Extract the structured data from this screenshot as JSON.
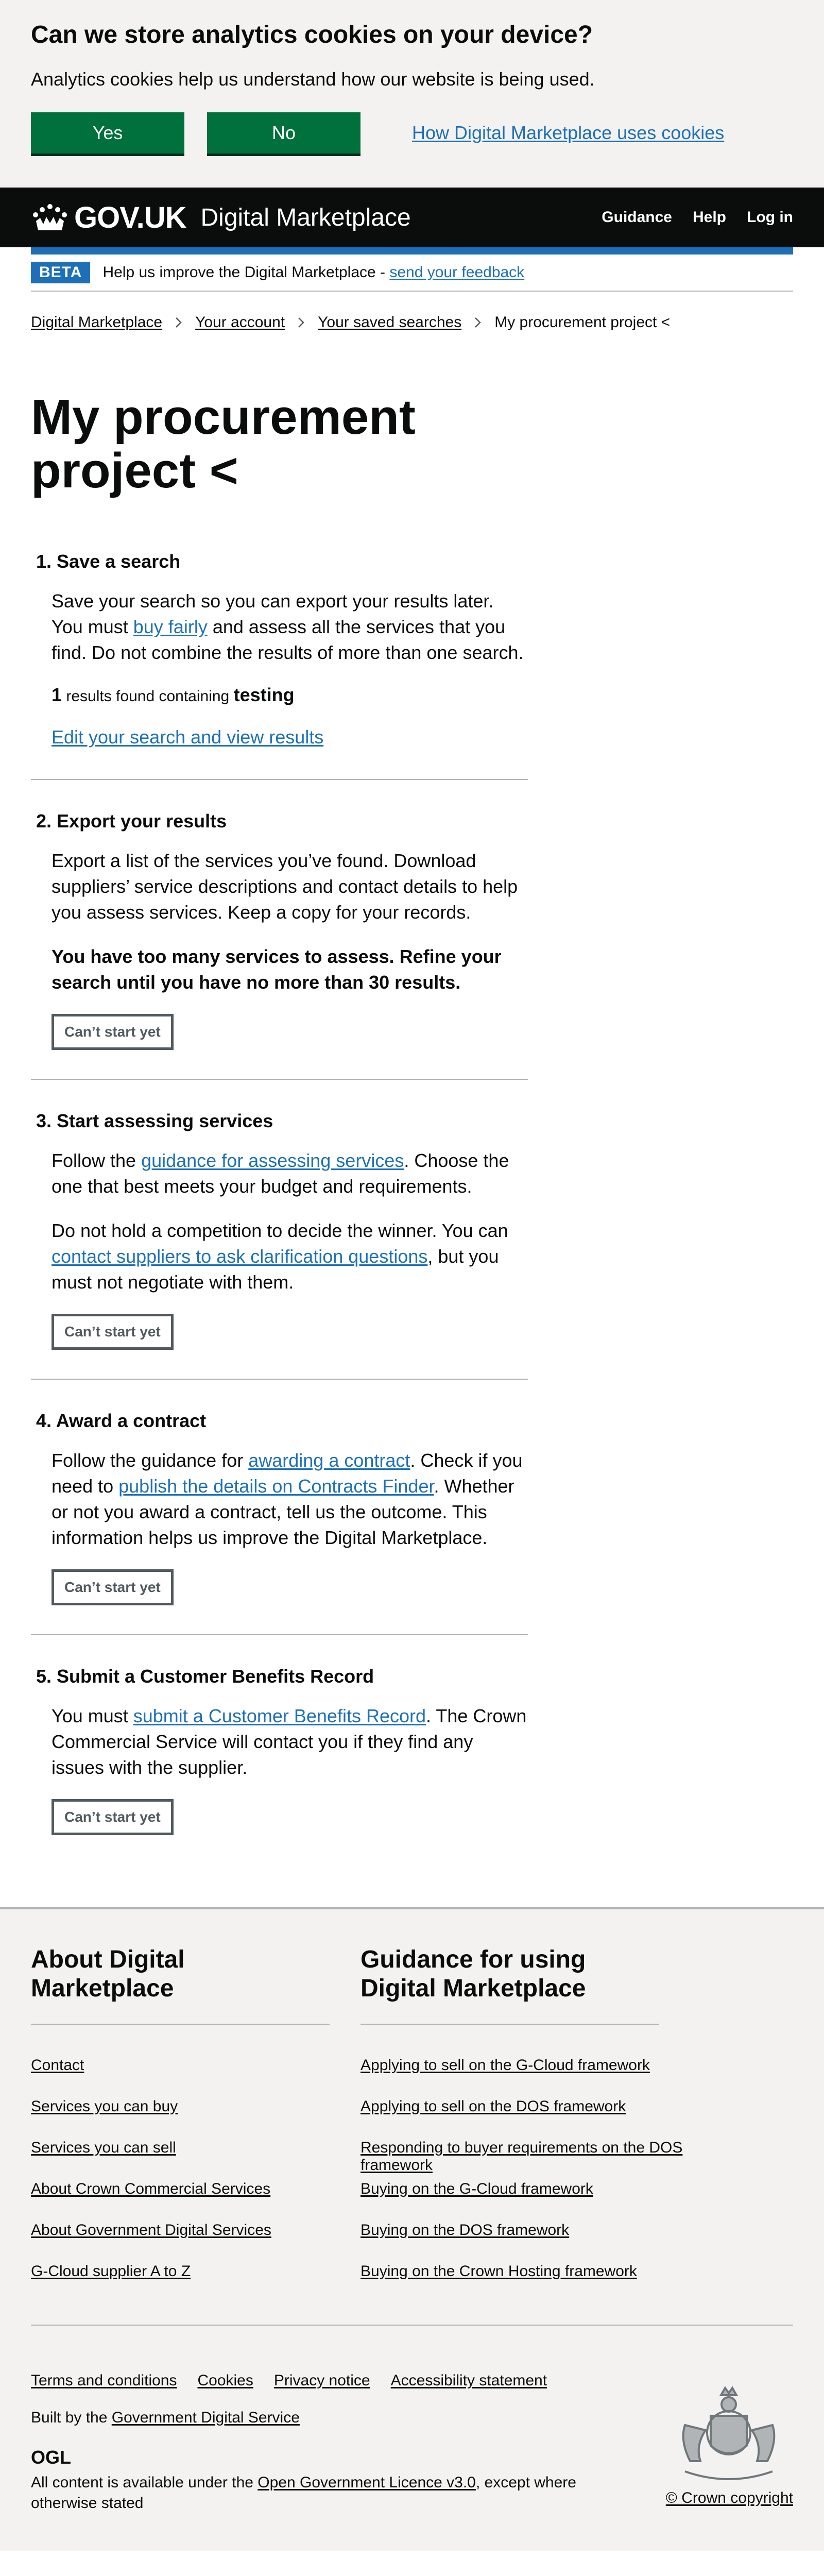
{
  "cookie": {
    "title": "Can we store analytics cookies on your device?",
    "text": "Analytics cookies help us understand how our website is being used.",
    "yes_label": "Yes",
    "no_label": "No",
    "info_link": "How Digital Marketplace uses cookies"
  },
  "header": {
    "gov": "GOV.UK",
    "service": "Digital Marketplace",
    "nav": [
      "Guidance",
      "Help",
      "Log in"
    ]
  },
  "beta": {
    "tag": "BETA",
    "text": "Help us improve the Digital Marketplace - ",
    "link": "send your feedback"
  },
  "breadcrumbs": [
    "Digital Marketplace",
    "Your account",
    "Your saved searches",
    "My procurement project <"
  ],
  "page_title": "My procurement project <",
  "steps": [
    {
      "heading": "Save a search",
      "p1_a": "Save your search so you can export your results later. You must ",
      "p1_link": "buy fairly",
      "p1_b": " and assess all the services that you find. Do not combine the results of more than one search.",
      "count": "1",
      "count_text": " results found containing ",
      "term": "testing",
      "link": "Edit your search and view results"
    },
    {
      "heading": "Export your results",
      "p1": "Export a list of the services you’ve found. Download suppliers’ service descriptions and contact details to help you assess services. Keep a copy for your records.",
      "p2": "You have too many services to assess. Refine your search until you have no more than 30 results.",
      "button": "Can’t start yet"
    },
    {
      "heading": "Start assessing services",
      "p1_a": "Follow the ",
      "p1_link": "guidance for assessing services",
      "p1_b": ". Choose the one that best meets your budget and requirements.",
      "p2_a": "Do not hold a competition to decide the winner. You can ",
      "p2_link": "contact suppliers to ask clarification questions",
      "p2_b": ", but you must not negotiate with them.",
      "button": "Can’t start yet"
    },
    {
      "heading": "Award a contract",
      "p1_a": "Follow the guidance for ",
      "p1_link": "awarding a contract",
      "p1_b": ". Check if you need to ",
      "p1_link2": "publish the details on Contracts Finder",
      "p1_c": ". Whether or not you award a contract, tell us the outcome. This information helps us improve the Digital Marketplace.",
      "button": "Can’t start yet"
    },
    {
      "heading": "Submit a Customer Benefits Record",
      "p1_a": "You must ",
      "p1_link": "submit a Customer Benefits Record",
      "p1_b": ". The Crown Commercial Service will contact you if they find any issues with the supplier.",
      "button": "Can’t start yet"
    }
  ],
  "footer": {
    "col1_title": "About Digital Marketplace",
    "col1_links": [
      "Contact",
      "Services you can buy",
      "Services you can sell",
      "About Crown Commercial Services",
      "About Government Digital Services",
      "G-Cloud supplier A to Z"
    ],
    "col2_title": "Guidance for using Digital Marketplace",
    "col2_links": [
      "Applying to sell on the G-Cloud framework",
      "Applying to sell on the DOS framework",
      "Responding to buyer requirements on the DOS framework",
      "Buying on the G-Cloud framework",
      "Buying on the DOS framework",
      "Buying on the Crown Hosting framework"
    ],
    "meta_links": [
      "Terms and conditions",
      "Cookies",
      "Privacy notice",
      "Accessibility statement"
    ],
    "built_a": "Built by the ",
    "built_link": "Government Digital Service",
    "ogl": "OGL",
    "licence_a": "All content is available under the ",
    "licence_link": "Open Government Licence v3.0",
    "licence_b": ", except where otherwise stated",
    "copyright": "© Crown copyright"
  },
  "colors": {
    "link": "#1d70b8",
    "button_green": "#00703c",
    "header_black": "#0b0c0c",
    "footer_grey": "#f3f2f1"
  }
}
